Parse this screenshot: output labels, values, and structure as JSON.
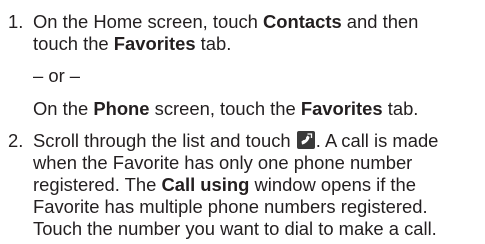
{
  "step1": {
    "number": "1.",
    "line1_pre": "On the Home screen, touch ",
    "line1_bold": "Contacts",
    "line1_post": " and then",
    "line2_pre": "touch the ",
    "line2_bold": "Favorites",
    "line2_post": " tab."
  },
  "or_text": "– or –",
  "alt": {
    "pre": "On the ",
    "bold1": "Phone",
    "mid": " screen, touch the ",
    "bold2": "Favorites",
    "post": " tab."
  },
  "step2": {
    "number": "2.",
    "line1_pre": "Scroll through the list and touch ",
    "line1_post": ". A call is made",
    "line2": "when the Favorite has only one phone number",
    "line3_pre": "registered.  The ",
    "line3_bold": "Call using",
    "line3_post": " window opens if the",
    "line4": "Favorite has multiple phone numbers registered.",
    "line5": "Touch the number you want to dial to make a call.",
    "icon": "phone-call-icon"
  }
}
